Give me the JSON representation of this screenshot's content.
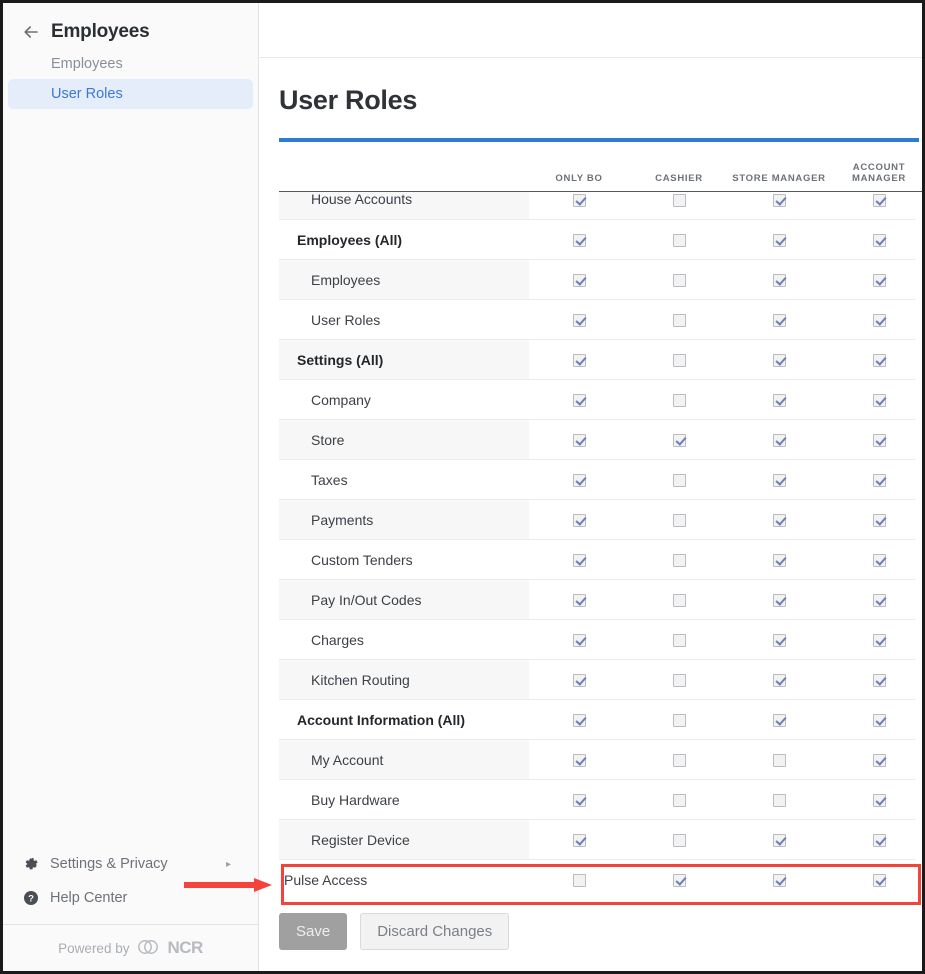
{
  "sidebar": {
    "back_icon": "back-arrow-icon",
    "title": "Employees",
    "items": [
      {
        "label": "Employees",
        "active": false
      },
      {
        "label": "User Roles",
        "active": true
      }
    ],
    "bottom_links": [
      {
        "label": "Settings & Privacy",
        "icon": "gear-icon",
        "chevron": "▸"
      },
      {
        "label": "Help Center",
        "icon": "help-circle-icon",
        "chevron": ""
      }
    ],
    "powered_by": "Powered by",
    "brand": "NCR"
  },
  "main": {
    "page_title": "User Roles",
    "accent_color": "#2b7cd3"
  },
  "table": {
    "label_column_header": "",
    "columns": [
      "ONLY BO",
      "CASHIER",
      "STORE MANAGER",
      "ACCOUNT MANAGER"
    ],
    "rows": [
      {
        "label": "House Accounts",
        "type": "child",
        "clipped": true,
        "checks": [
          true,
          false,
          true,
          true
        ]
      },
      {
        "label": "Employees (All)",
        "type": "group",
        "clipped": false,
        "checks": [
          true,
          false,
          true,
          true
        ]
      },
      {
        "label": "Employees",
        "type": "child",
        "clipped": false,
        "checks": [
          true,
          false,
          true,
          true
        ]
      },
      {
        "label": "User Roles",
        "type": "child",
        "clipped": false,
        "checks": [
          true,
          false,
          true,
          true
        ]
      },
      {
        "label": "Settings (All)",
        "type": "group",
        "clipped": false,
        "checks": [
          true,
          false,
          true,
          true
        ]
      },
      {
        "label": "Company",
        "type": "child",
        "clipped": false,
        "checks": [
          true,
          false,
          true,
          true
        ]
      },
      {
        "label": "Store",
        "type": "child",
        "clipped": false,
        "checks": [
          true,
          true,
          true,
          true
        ]
      },
      {
        "label": "Taxes",
        "type": "child",
        "clipped": false,
        "checks": [
          true,
          false,
          true,
          true
        ]
      },
      {
        "label": "Payments",
        "type": "child",
        "clipped": false,
        "checks": [
          true,
          false,
          true,
          true
        ]
      },
      {
        "label": "Custom Tenders",
        "type": "child",
        "clipped": false,
        "checks": [
          true,
          false,
          true,
          true
        ]
      },
      {
        "label": "Pay In/Out Codes",
        "type": "child",
        "clipped": false,
        "checks": [
          true,
          false,
          true,
          true
        ]
      },
      {
        "label": "Charges",
        "type": "child",
        "clipped": false,
        "checks": [
          true,
          false,
          true,
          true
        ]
      },
      {
        "label": "Kitchen Routing",
        "type": "child",
        "clipped": false,
        "checks": [
          true,
          false,
          true,
          true
        ]
      },
      {
        "label": "Account Information (All)",
        "type": "group",
        "clipped": false,
        "checks": [
          true,
          false,
          true,
          true
        ]
      },
      {
        "label": "My Account",
        "type": "child",
        "clipped": false,
        "checks": [
          true,
          false,
          false,
          true
        ]
      },
      {
        "label": "Buy Hardware",
        "type": "child",
        "clipped": false,
        "checks": [
          true,
          false,
          false,
          true
        ]
      },
      {
        "label": "Register Device",
        "type": "child",
        "clipped": false,
        "checks": [
          true,
          false,
          true,
          true
        ]
      },
      {
        "label": "Pulse Access",
        "type": "flat",
        "clipped": false,
        "checks": [
          false,
          true,
          true,
          true
        ]
      }
    ]
  },
  "footer": {
    "save_label": "Save",
    "discard_label": "Discard Changes"
  },
  "annotations": {
    "highlight_color": "#f4433a",
    "highlight_target": "Pulse Access",
    "arrow_color": "#f4433a"
  }
}
